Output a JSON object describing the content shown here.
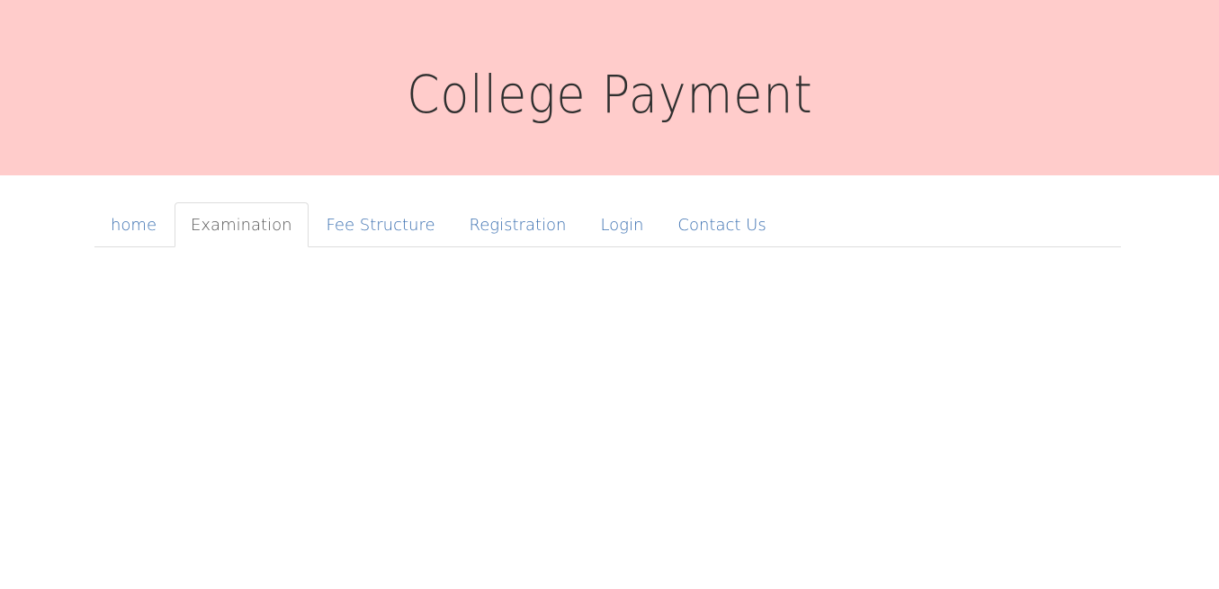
{
  "header": {
    "title": "College Payment",
    "background": "#ffcccb"
  },
  "nav": {
    "active_index": 1,
    "link_color": "#3a6fb0",
    "tabs": [
      {
        "label": "home"
      },
      {
        "label": "Examination"
      },
      {
        "label": "Fee Structure"
      },
      {
        "label": "Registration"
      },
      {
        "label": "Login"
      },
      {
        "label": "Contact Us"
      }
    ]
  }
}
